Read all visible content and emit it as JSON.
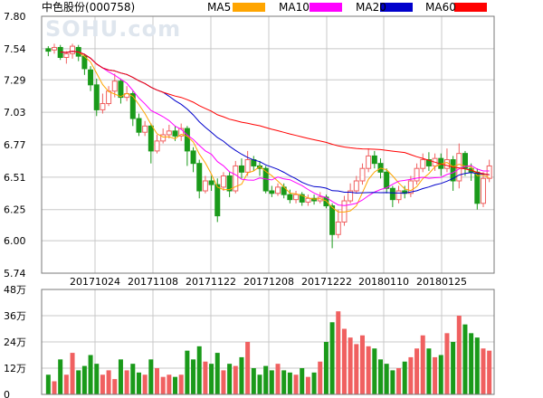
{
  "header": {
    "stock_name": "中色股份",
    "stock_code": "(000758)",
    "watermark": "SOHU.com"
  },
  "legend": [
    {
      "label": "MA5",
      "color": "#ffa500"
    },
    {
      "label": "MA10",
      "color": "#ff00ff"
    },
    {
      "label": "MA20",
      "color": "#0000cc"
    },
    {
      "label": "MA60",
      "color": "#ff0000"
    }
  ],
  "colors": {
    "up": "#f06060",
    "down": "#1a9a1a",
    "grid": "#c8c8c8",
    "frame": "#7a7a7a"
  },
  "chart_data": {
    "type": "candlestick",
    "price_axis": {
      "ticks": [
        "7.80",
        "7.54",
        "7.29",
        "7.03",
        "6.77",
        "6.51",
        "6.25",
        "6.00",
        "5.74"
      ],
      "ylim": [
        5.74,
        7.8
      ]
    },
    "volume_axis": {
      "ticks": [
        "48万",
        "36万",
        "24万",
        "12万",
        "0"
      ],
      "ylim": [
        0,
        48
      ],
      "unit": "万"
    },
    "date_ticks": [
      "20171024",
      "20171108",
      "20171122",
      "20171208",
      "20171222",
      "20180110",
      "20180125"
    ],
    "candles": [
      [
        7.54,
        7.52,
        7.56,
        7.48,
        9
      ],
      [
        7.53,
        7.55,
        7.58,
        7.5,
        6
      ],
      [
        7.55,
        7.47,
        7.57,
        7.45,
        16
      ],
      [
        7.47,
        7.5,
        7.52,
        7.42,
        9
      ],
      [
        7.5,
        7.56,
        7.58,
        7.46,
        19
      ],
      [
        7.55,
        7.48,
        7.57,
        7.44,
        11
      ],
      [
        7.48,
        7.38,
        7.5,
        7.33,
        13
      ],
      [
        7.37,
        7.25,
        7.4,
        7.2,
        18
      ],
      [
        7.25,
        7.05,
        7.3,
        7.0,
        14
      ],
      [
        7.05,
        7.1,
        7.18,
        7.02,
        9
      ],
      [
        7.1,
        7.2,
        7.24,
        7.08,
        11
      ],
      [
        7.2,
        7.28,
        7.34,
        7.15,
        7
      ],
      [
        7.28,
        7.15,
        7.3,
        7.1,
        16
      ],
      [
        7.15,
        7.18,
        7.24,
        7.12,
        11
      ],
      [
        7.18,
        6.98,
        7.2,
        6.92,
        14
      ],
      [
        6.98,
        6.87,
        7.02,
        6.84,
        10
      ],
      [
        6.87,
        6.92,
        6.96,
        6.84,
        9
      ],
      [
        6.92,
        6.72,
        6.94,
        6.62,
        16
      ],
      [
        6.72,
        6.8,
        6.85,
        6.7,
        12
      ],
      [
        6.8,
        6.85,
        6.9,
        6.78,
        8
      ],
      [
        6.85,
        6.88,
        6.93,
        6.82,
        9
      ],
      [
        6.88,
        6.84,
        6.92,
        6.8,
        8
      ],
      [
        6.84,
        6.9,
        6.94,
        6.8,
        9
      ],
      [
        6.9,
        6.72,
        6.92,
        6.6,
        20
      ],
      [
        6.72,
        6.62,
        6.75,
        6.55,
        16
      ],
      [
        6.62,
        6.4,
        6.65,
        6.34,
        22
      ],
      [
        6.4,
        6.48,
        6.52,
        6.38,
        15
      ],
      [
        6.48,
        6.45,
        6.52,
        6.4,
        14
      ],
      [
        6.45,
        6.2,
        6.5,
        6.15,
        19
      ],
      [
        6.43,
        6.52,
        6.55,
        6.4,
        11
      ],
      [
        6.52,
        6.4,
        6.55,
        6.35,
        14
      ],
      [
        6.4,
        6.6,
        6.64,
        6.38,
        13
      ],
      [
        6.6,
        6.55,
        6.66,
        6.5,
        17
      ],
      [
        6.55,
        6.65,
        6.72,
        6.52,
        24
      ],
      [
        6.65,
        6.6,
        6.68,
        6.56,
        12
      ],
      [
        6.6,
        6.58,
        6.64,
        6.52,
        9
      ],
      [
        6.58,
        6.4,
        6.6,
        6.38,
        13
      ],
      [
        6.4,
        6.38,
        6.44,
        6.35,
        11
      ],
      [
        6.38,
        6.43,
        6.46,
        6.36,
        14
      ],
      [
        6.43,
        6.37,
        6.46,
        6.34,
        11
      ],
      [
        6.37,
        6.33,
        6.41,
        6.3,
        10
      ],
      [
        6.33,
        6.37,
        6.4,
        6.3,
        9
      ],
      [
        6.37,
        6.31,
        6.39,
        6.28,
        12
      ],
      [
        6.31,
        6.34,
        6.37,
        6.28,
        8
      ],
      [
        6.34,
        6.32,
        6.37,
        6.29,
        10
      ],
      [
        6.32,
        6.35,
        6.39,
        6.3,
        15
      ],
      [
        6.35,
        6.28,
        6.37,
        6.26,
        24
      ],
      [
        6.28,
        6.05,
        6.3,
        5.94,
        33
      ],
      [
        6.05,
        6.15,
        6.25,
        6.02,
        38
      ],
      [
        6.15,
        6.32,
        6.36,
        6.12,
        30
      ],
      [
        6.32,
        6.4,
        6.46,
        6.3,
        26
      ],
      [
        6.4,
        6.48,
        6.52,
        6.38,
        23
      ],
      [
        6.48,
        6.58,
        6.62,
        6.45,
        27
      ],
      [
        6.58,
        6.68,
        6.74,
        6.55,
        22
      ],
      [
        6.68,
        6.62,
        6.72,
        6.58,
        21
      ],
      [
        6.62,
        6.55,
        6.66,
        6.5,
        16
      ],
      [
        6.55,
        6.42,
        6.58,
        6.38,
        14
      ],
      [
        6.42,
        6.33,
        6.44,
        6.27,
        11
      ],
      [
        6.33,
        6.4,
        6.44,
        6.3,
        12
      ],
      [
        6.4,
        6.38,
        6.44,
        6.34,
        15
      ],
      [
        6.38,
        6.48,
        6.52,
        6.35,
        17
      ],
      [
        6.48,
        6.58,
        6.62,
        6.45,
        21
      ],
      [
        6.58,
        6.65,
        6.7,
        6.55,
        27
      ],
      [
        6.65,
        6.6,
        6.71,
        6.56,
        21
      ],
      [
        6.6,
        6.66,
        6.7,
        6.56,
        17
      ],
      [
        6.66,
        6.58,
        6.7,
        6.52,
        18
      ],
      [
        6.58,
        6.65,
        6.74,
        6.55,
        28
      ],
      [
        6.65,
        6.48,
        6.68,
        6.4,
        24
      ],
      [
        6.48,
        6.7,
        6.78,
        6.42,
        36
      ],
      [
        6.7,
        6.58,
        6.72,
        6.52,
        32
      ],
      [
        6.58,
        6.55,
        6.62,
        6.48,
        28
      ],
      [
        6.55,
        6.3,
        6.58,
        6.25,
        26
      ],
      [
        6.3,
        6.5,
        6.55,
        6.27,
        21
      ],
      [
        6.5,
        6.6,
        6.65,
        6.47,
        20
      ]
    ]
  }
}
